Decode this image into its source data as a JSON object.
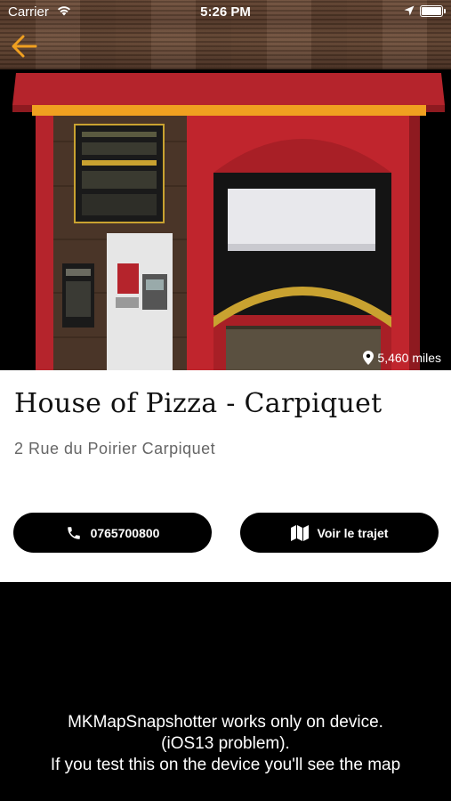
{
  "status_bar": {
    "carrier": "Carrier",
    "time": "5:26 PM",
    "icons": [
      "wifi-icon",
      "location-arrow-icon",
      "battery-icon"
    ]
  },
  "nav": {
    "back_icon": "arrow-left-icon",
    "accent_color": "#f0a020"
  },
  "hero": {
    "image": "pizza-vending-kiosk-photo",
    "distance": "5,460 miles",
    "distance_icon": "map-pin-icon"
  },
  "place": {
    "name": "House of Pizza - Carpiquet",
    "address": "2 Rue du Poirier Carpiquet"
  },
  "actions": {
    "call_label": "0765700800",
    "call_icon": "phone-icon",
    "route_label": "Voir le trajet",
    "route_icon": "map-icon"
  },
  "map": {
    "message_line1": "MKMapSnapshotter works only on device.",
    "message_line2": "(iOS13 problem).",
    "message_line3": "If you test this on the device you'll see the map"
  }
}
